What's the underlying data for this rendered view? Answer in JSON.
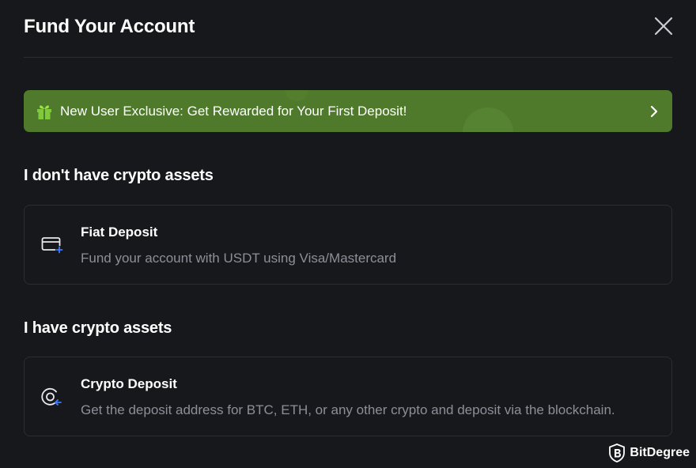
{
  "modal": {
    "title": "Fund Your Account"
  },
  "banner": {
    "text": "New User Exclusive: Get Rewarded for Your First Deposit!",
    "icon": "gift-icon",
    "background": "#4f7a2c"
  },
  "sections": [
    {
      "title": "I don't have crypto assets",
      "card": {
        "title": "Fiat Deposit",
        "description": "Fund your account with USDT using Visa/Mastercard",
        "icon": "credit-card-icon"
      }
    },
    {
      "title": "I have crypto assets",
      "card": {
        "title": "Crypto Deposit",
        "description": "Get the deposit address for BTC, ETH, or any other crypto and deposit via the blockchain.",
        "icon": "crypto-deposit-icon"
      }
    }
  ],
  "watermark": {
    "text": "BitDegree"
  },
  "colors": {
    "background": "#17181c",
    "accent_blue": "#3d7bff",
    "banner_green": "#4f7a2c"
  }
}
